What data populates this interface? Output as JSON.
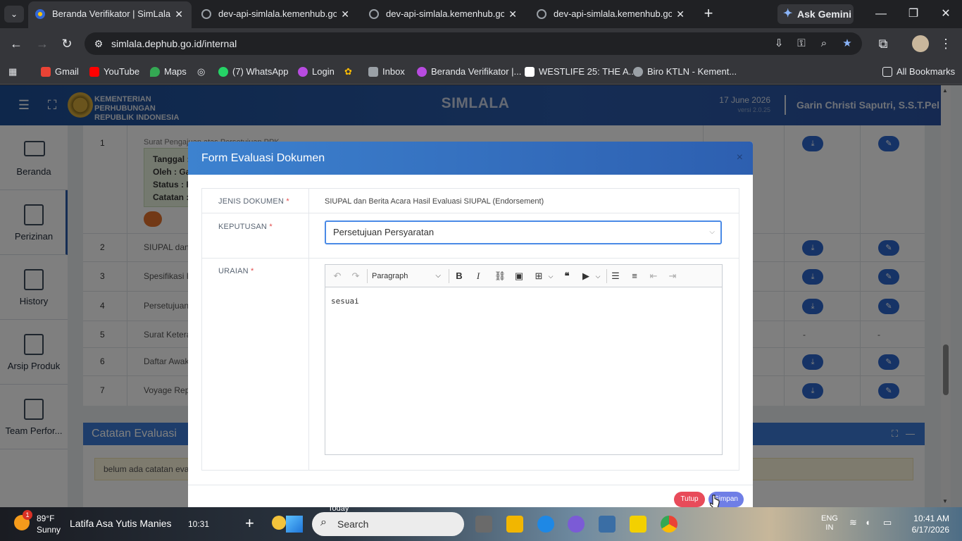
{
  "browser": {
    "tabs": [
      {
        "title": "Beranda Verifikator | SimLala",
        "active": true
      },
      {
        "title": "dev-api-simlala.kemenhub.go.id",
        "active": false
      },
      {
        "title": "dev-api-simlala.kemenhub.go.id",
        "active": false
      },
      {
        "title": "dev-api-simlala.kemenhub.go.id",
        "active": false
      }
    ],
    "gemini_label": "Ask Gemini",
    "url": "simlala.dephub.go.id/internal",
    "bookmarks": [
      {
        "label": "Gmail",
        "color": "#ea4335"
      },
      {
        "label": "YouTube",
        "color": "#ff0000"
      },
      {
        "label": "Maps",
        "color": "#34a853"
      },
      {
        "label": "(7) WhatsApp",
        "color": "#25d366"
      },
      {
        "label": "Login",
        "color": "#b84be0"
      },
      {
        "label": "Inbox",
        "color": "#9aa0a6"
      },
      {
        "label": "Beranda Verifikator |...",
        "color": "#b84be0"
      },
      {
        "label": "WESTLIFE 25: THE A...",
        "color": "#ffffff"
      },
      {
        "label": "Biro KTLN - Kement...",
        "color": "#9aa0a6"
      }
    ],
    "all_bookmarks": "All Bookmarks"
  },
  "app": {
    "org_line1": "KEMENTERIAN PERHUBUNGAN",
    "org_line2": "REPUBLIK INDONESIA",
    "title": "SIMLALA",
    "date": "17 June 2026",
    "version": "versi 2.0.25",
    "user": "Garin Christi Saputri, S.S.T.Pel",
    "accent_color": "#2a5aa8"
  },
  "sidebar": {
    "items": [
      {
        "label": "Beranda",
        "icon": "monitor-icon"
      },
      {
        "label": "Perizinan",
        "icon": "document-icon"
      },
      {
        "label": "History",
        "icon": "document-icon"
      },
      {
        "label": "Arsip Produk",
        "icon": "document-icon"
      },
      {
        "label": "Team Perfor..."
      }
    ]
  },
  "doc_table": {
    "rows": [
      {
        "no": "1",
        "name": "Surat Pengajuan atas Persetujuan PPK"
      },
      {
        "no": "2",
        "name": "SIUPAL dan B"
      },
      {
        "no": "3",
        "name": "Spesifikasi K"
      },
      {
        "no": "4",
        "name": "Persetujuan S"
      },
      {
        "no": "5",
        "name": "Surat Keteran"
      },
      {
        "no": "6",
        "name": "Daftar Awak"
      },
      {
        "no": "7",
        "name": "Voyage Repo"
      }
    ],
    "status_box": {
      "line1": "Tanggal :",
      "line2": "Oleh : Ga",
      "line3": "Status : P",
      "line4": "Catatan :"
    },
    "dash": "-"
  },
  "evaluation": {
    "title": "Catatan Evaluasi",
    "note": "belum ada catatan evalu"
  },
  "modal": {
    "title": "Form Evaluasi Dokumen",
    "close": "×",
    "labels": {
      "jenis": "JENIS DOKUMEN",
      "keputusan": "KEPUTUSAN",
      "uraian": "URAIAN",
      "required_mark": "*"
    },
    "jenis_value": "SIUPAL dan Berita Acara Hasil Evaluasi SIUPAL (Endorsement)",
    "keputusan_value": "Persetujuan Persyaratan",
    "editor": {
      "paragraph_label": "Paragraph",
      "content": "sesuai"
    },
    "btn_close": "Tutup",
    "btn_save": "Simpan"
  },
  "taskbar": {
    "temperature": "89°F",
    "weather": "Sunny",
    "weather_badge": "1",
    "event_title": "Latifa Asa Yutis Manies",
    "event_time": "10:31",
    "today_label": "Today",
    "search_placeholder": "Search",
    "lang_1": "ENG",
    "lang_2": "IN",
    "time": "10:41 AM",
    "date": "6/17/2026"
  }
}
